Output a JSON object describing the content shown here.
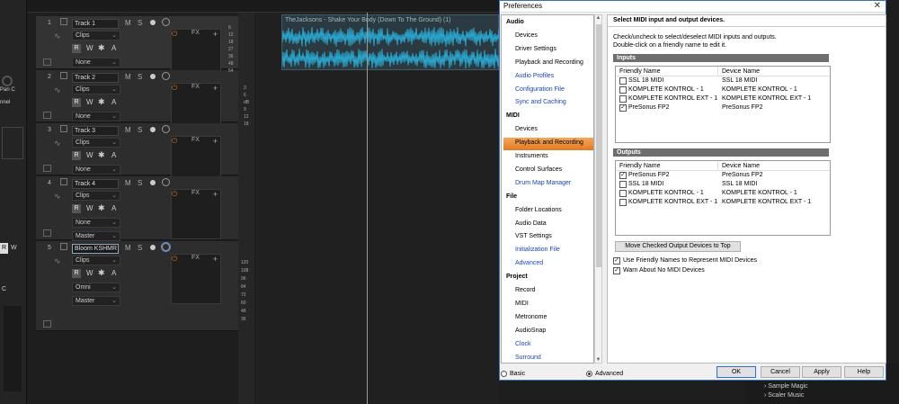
{
  "daw": {
    "tracks": [
      {
        "num": "1",
        "name": "Track 1",
        "input": "Clips",
        "output": "None",
        "output_icon": "",
        "fx": "FX",
        "selected": true
      },
      {
        "num": "2",
        "name": "Track 2",
        "input": "Clips",
        "output": "None",
        "output_icon": "",
        "fx": "FX",
        "selected": false
      },
      {
        "num": "3",
        "name": "Track 3",
        "input": "Clips",
        "output": "None",
        "output_icon": "",
        "fx": "FX",
        "selected": false
      },
      {
        "num": "4",
        "name": "Track 4",
        "input": "Clips",
        "output": "None",
        "extra": "Master",
        "fx": "FX",
        "selected": false
      },
      {
        "num": "5",
        "name": "Bloom KSHMR 1",
        "input": "Clips",
        "output": "Omni",
        "extra": "Master",
        "fx": "FX",
        "selected": false
      }
    ],
    "msr": {
      "m": "M",
      "s": "S",
      "r": "R",
      "w": "W",
      "star": "✱",
      "a": "A"
    },
    "clip_title": "TheJacksons - Shake Your Body (Down To The Ground) (1)",
    "meter_ticks_a": [
      "6",
      "12",
      "18",
      "27",
      "36",
      "48",
      "54"
    ],
    "meter_ticks_b": [
      "3",
      "6",
      "dB",
      "9",
      "12",
      "18"
    ],
    "meter_ticks_c": [
      "120",
      "108",
      "96",
      "84",
      "72",
      "60",
      "48",
      "36"
    ],
    "left_labels": {
      "pan": "Pan C",
      "chnl": "nnel",
      "w": "W",
      "c": "C",
      "r": "R"
    },
    "right_list": [
      "Sample Magic",
      "Scaler Music"
    ]
  },
  "dialog": {
    "title": "Preferences",
    "close": "✕",
    "nav": [
      {
        "type": "head",
        "label": "Audio"
      },
      {
        "type": "item",
        "label": "Devices",
        "blue": false
      },
      {
        "type": "item",
        "label": "Driver Settings",
        "blue": false
      },
      {
        "type": "item",
        "label": "Playback and Recording",
        "blue": false
      },
      {
        "type": "item",
        "label": "Audio Profiles",
        "blue": true
      },
      {
        "type": "item",
        "label": "Configuration File",
        "blue": true
      },
      {
        "type": "item",
        "label": "Sync and Caching",
        "blue": true
      },
      {
        "type": "head",
        "label": "MIDI"
      },
      {
        "type": "item",
        "label": "Devices",
        "blue": false,
        "selected": true
      },
      {
        "type": "item",
        "label": "Playback and Recording",
        "blue": false
      },
      {
        "type": "item",
        "label": "Instruments",
        "blue": false
      },
      {
        "type": "item",
        "label": "Control Surfaces",
        "blue": false
      },
      {
        "type": "item",
        "label": "Drum Map Manager",
        "blue": true
      },
      {
        "type": "head",
        "label": "File"
      },
      {
        "type": "item",
        "label": "Folder Locations",
        "blue": false
      },
      {
        "type": "item",
        "label": "Audio Data",
        "blue": false
      },
      {
        "type": "item",
        "label": "VST Settings",
        "blue": false
      },
      {
        "type": "item",
        "label": "Initialization File",
        "blue": true
      },
      {
        "type": "item",
        "label": "Advanced",
        "blue": true
      },
      {
        "type": "head",
        "label": "Project"
      },
      {
        "type": "item",
        "label": "Record",
        "blue": false
      },
      {
        "type": "item",
        "label": "MIDI",
        "blue": false
      },
      {
        "type": "item",
        "label": "Metronome",
        "blue": false
      },
      {
        "type": "item",
        "label": "AudioSnap",
        "blue": false
      },
      {
        "type": "item",
        "label": "Clock",
        "blue": true
      },
      {
        "type": "item",
        "label": "Surround",
        "blue": true
      }
    ],
    "pane_title": "Select MIDI input and output devices.",
    "instructions_1": "Check/uncheck to select/deselect MIDI inputs and outputs.",
    "instructions_2": "Double-click on a friendly name to edit it.",
    "inputs_label": "Inputs",
    "outputs_label": "Outputs",
    "col_friendly": "Friendly Name",
    "col_device": "Device Name",
    "inputs": [
      {
        "checked": false,
        "friendly": "SSL 18 MIDI",
        "device": "SSL 18 MIDI"
      },
      {
        "checked": false,
        "friendly": "KOMPLETE KONTROL - 1",
        "device": "KOMPLETE KONTROL - 1"
      },
      {
        "checked": false,
        "friendly": "KOMPLETE KONTROL EXT - 1",
        "device": "KOMPLETE KONTROL EXT - 1"
      },
      {
        "checked": true,
        "friendly": "PreSonus FP2",
        "device": "PreSonus FP2"
      }
    ],
    "outputs": [
      {
        "checked": true,
        "friendly": "PreSonus FP2",
        "device": "PreSonus FP2"
      },
      {
        "checked": false,
        "friendly": "SSL 18 MIDI",
        "device": "SSL 18 MIDI"
      },
      {
        "checked": false,
        "friendly": "KOMPLETE KONTROL - 1",
        "device": "KOMPLETE KONTROL - 1"
      },
      {
        "checked": false,
        "friendly": "KOMPLETE KONTROL EXT - 1",
        "device": "KOMPLETE KONTROL EXT - 1"
      }
    ],
    "move_button": "Move Checked Output Devices to Top",
    "opt_friendly": "Use Friendly Names to Represent MIDI Devices",
    "opt_warn": "Warn About No MIDI Devices",
    "opt_friendly_checked": true,
    "opt_warn_checked": true,
    "mode_basic": "Basic",
    "mode_advanced": "Advanced",
    "mode_selected": "Advanced",
    "buttons": {
      "ok": "OK",
      "cancel": "Cancel",
      "apply": "Apply",
      "help": "Help"
    }
  }
}
